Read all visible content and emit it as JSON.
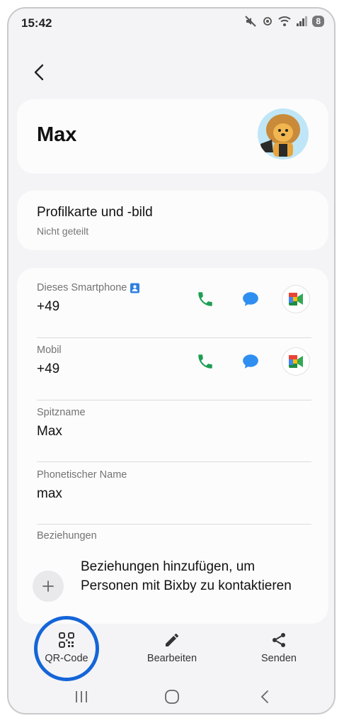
{
  "status_bar": {
    "time": "15:42",
    "battery_level": "8"
  },
  "contact": {
    "name": "Max",
    "profile_card": {
      "title": "Profilkarte und -bild",
      "subtitle": "Nicht geteilt"
    },
    "phones": [
      {
        "label": "Dieses Smartphone",
        "number": "+49"
      },
      {
        "label": "Mobil",
        "number": "+49"
      }
    ],
    "nickname": {
      "label": "Spitzname",
      "value": "Max"
    },
    "phonetic": {
      "label": "Phonetischer Name",
      "value": "max"
    },
    "relations": {
      "label": "Beziehungen",
      "add_text": "Beziehungen hinzufügen, um Personen mit Bixby zu kontaktieren"
    }
  },
  "bottom_nav": {
    "qr": "QR-Code",
    "edit": "Bearbeiten",
    "send": "Senden"
  },
  "colors": {
    "call_green": "#1e9e52",
    "message_blue": "#2f8ff0",
    "highlight_ring": "#1565d8"
  },
  "icons": [
    "back-icon",
    "phone-icon",
    "message-icon",
    "meet-icon",
    "qr-code-icon",
    "pencil-icon",
    "share-icon",
    "plus-icon"
  ]
}
